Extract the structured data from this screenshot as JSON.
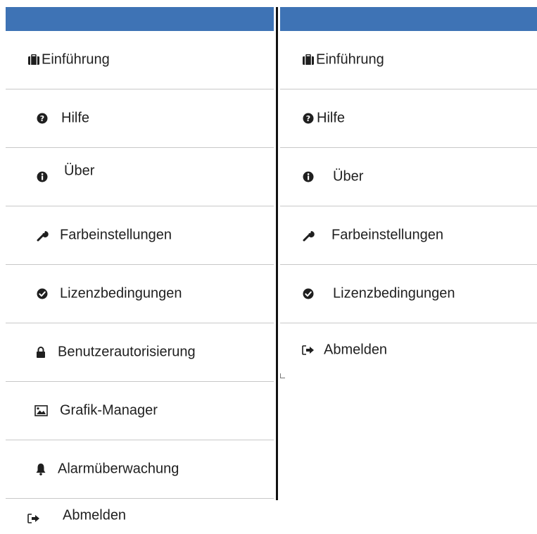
{
  "colors": {
    "header": "#3e73b5",
    "divider": "#111111",
    "rowBorder": "#c8c8c8"
  },
  "left_menu": {
    "items": [
      {
        "label": "Einführung",
        "icon": "briefcase-icon"
      },
      {
        "label": "Hilfe",
        "icon": "question-circle-icon"
      },
      {
        "label": "Über",
        "icon": "info-circle-icon"
      },
      {
        "label": "Farbeinstellungen",
        "icon": "wrench-icon"
      },
      {
        "label": "Lizenzbedingungen",
        "icon": "check-circle-icon"
      },
      {
        "label": "Benutzerautorisierung",
        "icon": "lock-icon"
      },
      {
        "label": "Grafik-Manager",
        "icon": "image-icon"
      },
      {
        "label": "Alarmüberwachung",
        "icon": "bell-icon"
      },
      {
        "label": "Abmelden",
        "icon": "sign-out-icon"
      }
    ]
  },
  "right_menu": {
    "items": [
      {
        "label": "Einführung",
        "icon": "briefcase-icon"
      },
      {
        "label": "Hilfe",
        "icon": "question-circle-icon"
      },
      {
        "label": "Über",
        "icon": "info-circle-icon"
      },
      {
        "label": "Farbeinstellungen",
        "icon": "wrench-icon"
      },
      {
        "label": "Lizenzbedingungen",
        "icon": "check-circle-icon"
      },
      {
        "label": "Abmelden",
        "icon": "sign-out-icon"
      }
    ]
  }
}
